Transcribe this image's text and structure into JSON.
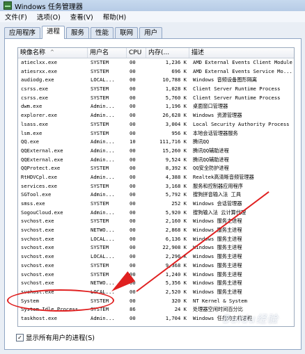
{
  "window": {
    "title": "Windows 任务管理器"
  },
  "menu": [
    "文件(F)",
    "选项(O)",
    "查看(V)",
    "帮助(H)"
  ],
  "tabs": [
    "应用程序",
    "进程",
    "服务",
    "性能",
    "联网",
    "用户"
  ],
  "active_tab": 1,
  "columns": [
    "映像名称",
    "用户名",
    "CPU",
    "内存(...",
    "描述"
  ],
  "processes": [
    {
      "name": "atieclxx.exe",
      "user": "SYSTEM",
      "cpu": "00",
      "mem": "1,236 K",
      "desc": "AMD External Events Client Module"
    },
    {
      "name": "atiesrxx.exe",
      "user": "SYSTEM",
      "cpu": "00",
      "mem": "696 K",
      "desc": "AMD External Events Service Mo..."
    },
    {
      "name": "audiodg.exe",
      "user": "LOCAL...",
      "cpu": "00",
      "mem": "10,788 K",
      "desc": "Windows 音频设备图形隔离"
    },
    {
      "name": "csrss.exe",
      "user": "SYSTEM",
      "cpu": "00",
      "mem": "1,028 K",
      "desc": "Client Server Runtime Process"
    },
    {
      "name": "csrss.exe",
      "user": "SYSTEM",
      "cpu": "00",
      "mem": "5,760 K",
      "desc": "Client Server Runtime Process"
    },
    {
      "name": "dwm.exe",
      "user": "Admin...",
      "cpu": "00",
      "mem": "1,196 K",
      "desc": "桌面窗口管理器"
    },
    {
      "name": "explorer.exe",
      "user": "Admin...",
      "cpu": "00",
      "mem": "26,628 K",
      "desc": "Windows 资源管理器"
    },
    {
      "name": "lsass.exe",
      "user": "SYSTEM",
      "cpu": "00",
      "mem": "3,004 K",
      "desc": "Local Security Authority Process"
    },
    {
      "name": "lsm.exe",
      "user": "SYSTEM",
      "cpu": "00",
      "mem": "956 K",
      "desc": "本地会话管理器服务"
    },
    {
      "name": "QQ.exe",
      "user": "Admin...",
      "cpu": "10",
      "mem": "111,716 K",
      "desc": "腾讯QQ"
    },
    {
      "name": "QQExternal.exe",
      "user": "Admin...",
      "cpu": "00",
      "mem": "15,260 K",
      "desc": "腾讯QQ辅助进程"
    },
    {
      "name": "QQExternal.exe",
      "user": "Admin...",
      "cpu": "00",
      "mem": "9,524 K",
      "desc": "腾讯QQ辅助进程"
    },
    {
      "name": "QQProtect.exe",
      "user": "SYSTEM",
      "cpu": "00",
      "mem": "8,392 K",
      "desc": "QQ安全防护进程"
    },
    {
      "name": "RtHDVCpl.exe",
      "user": "Admin...",
      "cpu": "00",
      "mem": "4,388 K",
      "desc": "Realtek高清晰音频管理器"
    },
    {
      "name": "services.exe",
      "user": "SYSTEM",
      "cpu": "00",
      "mem": "3,168 K",
      "desc": "服务和控制器应用程序"
    },
    {
      "name": "SGTool.exe",
      "user": "Admin...",
      "cpu": "00",
      "mem": "5,792 K",
      "desc": "搜狗拼音输入法 工具"
    },
    {
      "name": "smss.exe",
      "user": "SYSTEM",
      "cpu": "00",
      "mem": "252 K",
      "desc": "Windows 会话管理器"
    },
    {
      "name": "SogouCloud.exe",
      "user": "Admin...",
      "cpu": "00",
      "mem": "5,920 K",
      "desc": "搜狗输入法 云计算代理"
    },
    {
      "name": "svchost.exe",
      "user": "SYSTEM",
      "cpu": "00",
      "mem": "2,160 K",
      "desc": "Windows 服务主进程"
    },
    {
      "name": "svchost.exe",
      "user": "NETWO...",
      "cpu": "00",
      "mem": "2,868 K",
      "desc": "Windows 服务主进程"
    },
    {
      "name": "svchost.exe",
      "user": "LOCAL...",
      "cpu": "00",
      "mem": "6,136 K",
      "desc": "Windows 服务主进程"
    },
    {
      "name": "svchost.exe",
      "user": "SYSTEM",
      "cpu": "00",
      "mem": "22,908 K",
      "desc": "Windows 服务主进程"
    },
    {
      "name": "svchost.exe",
      "user": "LOCAL...",
      "cpu": "00",
      "mem": "2,296 K",
      "desc": "Windows 服务主进程"
    },
    {
      "name": "svchost.exe",
      "user": "SYSTEM",
      "cpu": "00",
      "mem": "9,368 K",
      "desc": "Windows 服务主进程"
    },
    {
      "name": "svchost.exe",
      "user": "SYSTEM",
      "cpu": "00",
      "mem": "1,240 K",
      "desc": "Windows 服务主进程"
    },
    {
      "name": "svchost.exe",
      "user": "NETWO...",
      "cpu": "00",
      "mem": "5,356 K",
      "desc": "Windows 服务主进程"
    },
    {
      "name": "svchost.exe",
      "user": "LOCAL...",
      "cpu": "00",
      "mem": "2,520 K",
      "desc": "Windows 服务主进程"
    },
    {
      "name": "System",
      "user": "SYSTEM",
      "cpu": "00",
      "mem": "320 K",
      "desc": "NT Kernel & System"
    },
    {
      "name": "System Idle Process",
      "user": "SYSTEM",
      "cpu": "86",
      "mem": "24 K",
      "desc": "处理器空闲时间百分比"
    },
    {
      "name": "taskhost.exe",
      "user": "Admin...",
      "cpu": "00",
      "mem": "1,704 K",
      "desc": "Windows 任务的主机进程"
    }
  ],
  "show_all_users": {
    "label": "显示所有用户的进程(S)",
    "checked": true
  },
  "watermark": "Baidu经验",
  "colors": {
    "annotation": "#e02020",
    "titlebar": "#c7d9ee"
  }
}
